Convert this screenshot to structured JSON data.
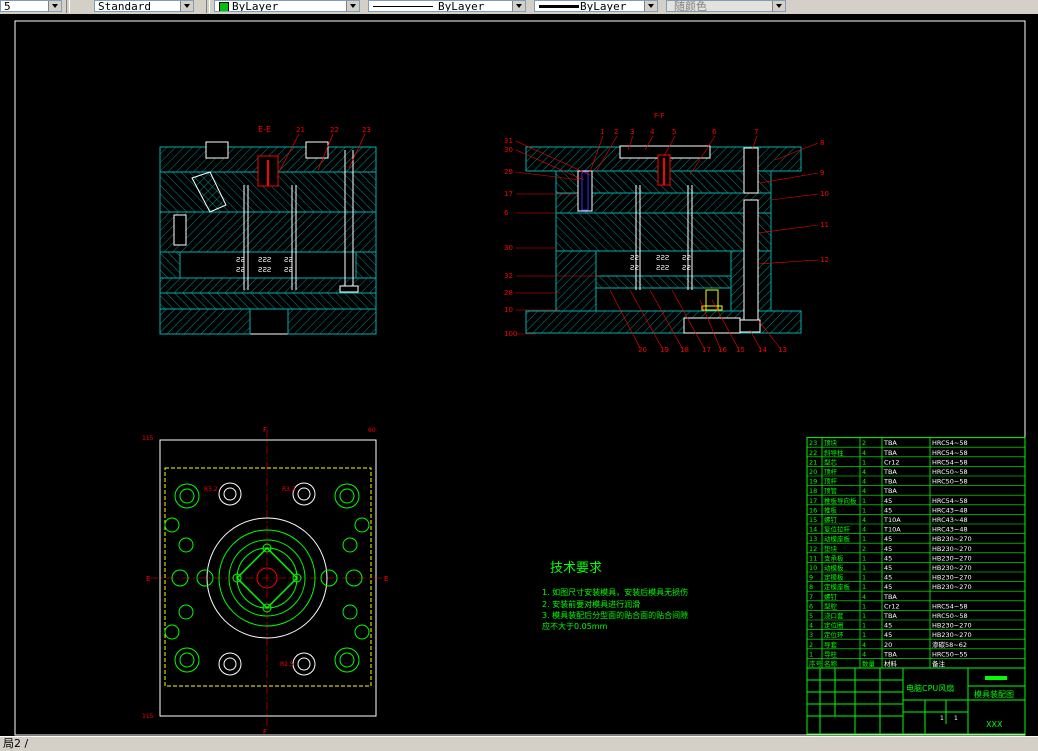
{
  "toolbar": {
    "left_fragment": "5",
    "textstyle": "Standard",
    "layer_color": "ByLayer",
    "linetype": "ByLayer",
    "lineweight": "ByLayer",
    "plotstyle": "随颜色",
    "colors": {
      "layer_swatch": "#00c000"
    }
  },
  "drawing": {
    "section_label_left": "E-E",
    "section_label_right": "F-F",
    "left_callouts": [
      "21",
      "22",
      "23"
    ],
    "right_top_callouts": [
      "1",
      "2",
      "3",
      "4",
      "5",
      "6",
      "7",
      "8"
    ],
    "right_left_callouts": [
      "31",
      "30",
      "29",
      "17",
      "6",
      "30",
      "32",
      "28",
      "10",
      "100"
    ],
    "right_right_callouts": [
      "9",
      "10",
      "11",
      "12"
    ],
    "right_bottom_callouts": [
      "20",
      "19",
      "18",
      "17",
      "16",
      "15",
      "14",
      "13"
    ],
    "plan_left_label": "115",
    "plan_right_label": "60",
    "plan_bottom_label": "115",
    "plan_top_F": "F",
    "plan_E": "E",
    "plan_dims": [
      "R3.2",
      "R3.2",
      "R2.5"
    ],
    "tech_title": "技术要求",
    "tech_notes": [
      "1. 如图尺寸安装模具，安装后模具无损伤",
      "2. 安装前要对模具进行润滑",
      "3. 模具装配后分型面的贴合面的贴合间隙",
      "   应不大于0.05mm"
    ],
    "colors": {
      "section_line": "#00b0b0",
      "hatch": "#00b0b0",
      "red": "#ff0000",
      "green": "#00ff00",
      "yellow": "#ffff00",
      "white": "#ffffff"
    }
  },
  "bom": {
    "rows": [
      [
        "23",
        "顶块",
        "2",
        "TBA",
        "HRC54~58"
      ],
      [
        "22",
        "斜导柱",
        "4",
        "TBA",
        "HRC54~58"
      ],
      [
        "21",
        "型芯",
        "1",
        "Cr12",
        "HRC54~58"
      ],
      [
        "20",
        "顶杆",
        "4",
        "TBA",
        "HRC50~58"
      ],
      [
        "19",
        "顶杆",
        "4",
        "TBA",
        "HRC50~58"
      ],
      [
        "18",
        "顶管",
        "4",
        "TBA",
        ""
      ],
      [
        "17",
        "推板导向板",
        "1",
        "45",
        "HRC54~58"
      ],
      [
        "16",
        "推板",
        "1",
        "45",
        "HRC43~48"
      ],
      [
        "15",
        "螺钉",
        "4",
        "T10A",
        "HRC43~48"
      ],
      [
        "14",
        "复位拉杆",
        "4",
        "T10A",
        "HRC43~48"
      ],
      [
        "13",
        "动模座板",
        "1",
        "45",
        "HB230~270"
      ],
      [
        "12",
        "垫块",
        "2",
        "45",
        "HB230~270"
      ],
      [
        "11",
        "支承板",
        "1",
        "45",
        "HB230~270"
      ],
      [
        "10",
        "动模板",
        "1",
        "45",
        "HB230~270"
      ],
      [
        "9",
        "定模板",
        "1",
        "45",
        "HB230~270"
      ],
      [
        "8",
        "定模座板",
        "1",
        "45",
        "HB230~270"
      ],
      [
        "7",
        "螺钉",
        "4",
        "TBA",
        ""
      ],
      [
        "6",
        "型腔",
        "1",
        "Cr12",
        "HRC54~58"
      ],
      [
        "5",
        "浇口套",
        "1",
        "TBA",
        "HRC50~58"
      ],
      [
        "4",
        "定位圈",
        "1",
        "45",
        "HB230~270"
      ],
      [
        "3",
        "定位环",
        "1",
        "45",
        "HB230~270"
      ],
      [
        "2",
        "导套",
        "4",
        "20",
        "渗碳58~62"
      ],
      [
        "1",
        "导柱",
        "4",
        "TBA",
        "HRC50~55"
      ]
    ],
    "header": [
      "序号",
      "名称",
      "数量",
      "材料",
      "备注"
    ],
    "title_product": "电脑CPU风扇",
    "title_drawing": "模具装配图",
    "sheet_a": "1",
    "sheet_b": "1",
    "company": "XXX"
  },
  "statusbar": {
    "layout_tab": "局2 /"
  }
}
